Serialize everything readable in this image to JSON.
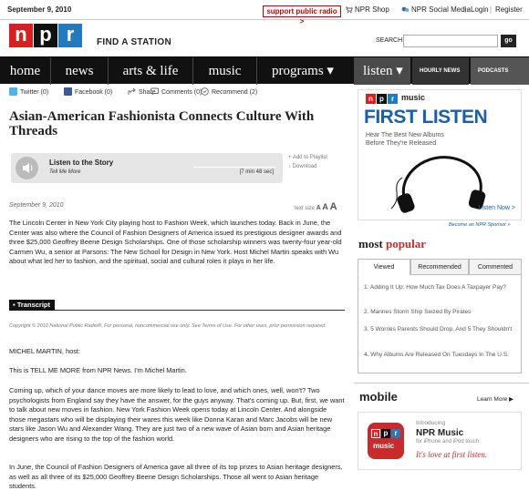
{
  "topbar": {
    "date": "September 9, 2010",
    "support": "support public radio >",
    "links": [
      "NPR Shop",
      "NPR Social Media",
      "Login",
      "Register"
    ]
  },
  "header": {
    "logo": [
      "n",
      "p",
      "r"
    ],
    "find_station": "FIND A STATION",
    "search_label": "SEARCH",
    "search_value": "",
    "go": "go"
  },
  "nav": {
    "items": [
      "home",
      "news",
      "arts & life",
      "music",
      "programs ▾"
    ],
    "listen": "listen ▾",
    "hourly": "HOURLY NEWS",
    "podcasts": "PODCASTS"
  },
  "social": {
    "twitter": "Twitter (0)",
    "facebook": "Facebook (0)",
    "share": "Share",
    "comments": "Comments (0)",
    "recommend": "Recommend (2)"
  },
  "article": {
    "title": "Asian-American Fashionista Connects Culture With Threads",
    "player": {
      "label": "Listen to the Story",
      "program": "Tell Me More",
      "duration": "[7 min 48 sec]",
      "add": "Add to Playlist",
      "download": "Download"
    },
    "date": "September 9, 2010",
    "text_size_label": "text size",
    "text_size_a": "A",
    "summary": "The Lincoln Center in New York City playing host to Fashion Week, which launches today. Back in June, the Center was also where the Council of Fashion Designers of America issued its prestigious designer awards and three $25,000 Geoffrey Beene Design Scholarships. One of those scholarship winners was twenty-four year-old Carmen Wu, a senior at Parsons: The New School for Design in New York. Host Michel Martin speaks with Wu about what led her to fashion, and the spiritual, social and cultural roles it plays in her life.",
    "transcript_label": "Transcript",
    "copyright": "Copyright © 2010 National Public Radio®. For personal, noncommercial use only. See Terms of Use. For other uses, prior permission required.",
    "paragraphs": [
      "MICHEL MARTIN, host:",
      "This is TELL ME MORE from NPR News. I'm Michel Martin.",
      "Coming up, which of your dance moves are more likely to lead to love, and which ones, well, won't? Two psychologists from England say they have the answer, for the guys anyway. That's coming up. But, first, we want to talk about new moves in fashion. New York Fashion Week opens today at Lincoln Center. And alongside those megastars who will be displaying their wares this week like Donna Karan and Marc Jacobs will be new stars like Jason Wu and Alexander Wang. They are just two of a new wave of Asian born and Asian heritage designers who are rising to the top of the fashion world.",
      "In June, the Council of Fashion Designers of America gave all three of its top prizes to Asian heritage designers, as well as all three of its $25,000 Geoffrey Beene Design Scholarships. Those all went to Asian heritage students."
    ]
  },
  "sidebar": {
    "ad": {
      "music": "music",
      "title": "FIRST LISTEN",
      "subtitle": "Hear The Best New Albums Before They're Released",
      "cta": "Listen Now >"
    },
    "sponsor": "Become an NPR Sponsor »",
    "most_popular": {
      "title_a": "most",
      "title_b": "popular",
      "tabs": [
        "Viewed",
        "Recommended",
        "Commented"
      ],
      "items": [
        "1. Adding It Up: How Much Tax Does A Taxpayer Pay?",
        "2. Mannes Storm Ship Seized By Pirates",
        "3. 5 Worries Parents Should Drop, And 5 They Shouldn't",
        "4. Why Albums Are Released On Tuesdays In The U.S."
      ]
    },
    "mobile": {
      "title": "mobile",
      "learn_more": "Learn More ▶",
      "icon_label": "music",
      "introducing": "Introducing",
      "app_name": "NPR Music",
      "platform": "for iPhone and iPod touch",
      "tagline": "It's love at first listen."
    }
  },
  "colors": {
    "npr_red": "#d62021",
    "npr_black": "#111111",
    "npr_blue": "#237bbd",
    "popular_red": "#c72b2b",
    "first_listen_blue": "#1a5fa7"
  }
}
